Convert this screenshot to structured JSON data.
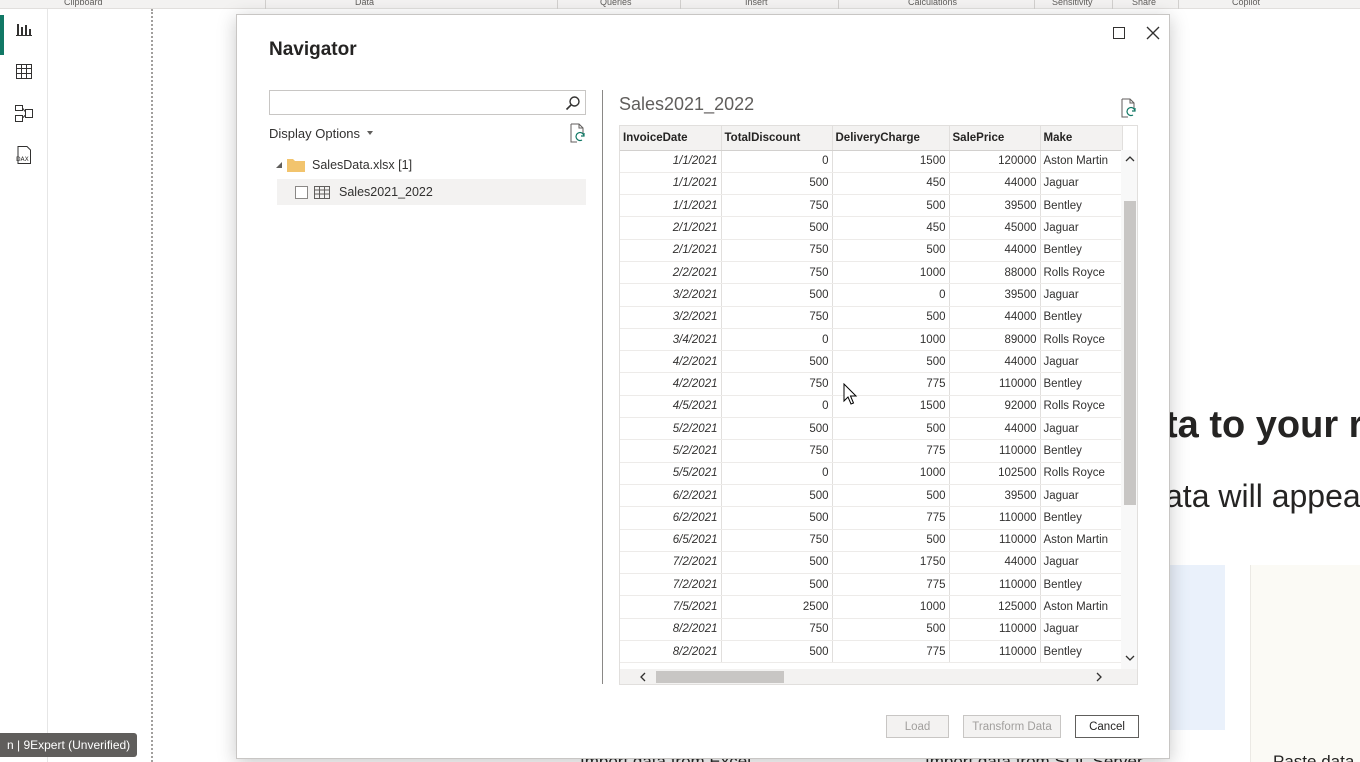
{
  "ribbon": {
    "groups": [
      "Clipboard",
      "Data",
      "Queries",
      "Insert",
      "Calculations",
      "Sensitivity",
      "Share",
      "Copilot"
    ]
  },
  "left_rail": {
    "items": [
      {
        "name": "report-view-icon",
        "active": true
      },
      {
        "name": "table-view-icon",
        "active": false
      },
      {
        "name": "model-view-icon",
        "active": false
      },
      {
        "name": "dax-query-view-icon",
        "active": false
      }
    ]
  },
  "background": {
    "heading": "ta to your r",
    "subheading": "ata will appea",
    "bottom_items": [
      "Import data from Excel",
      "Import data from SQL Server",
      "Paste data"
    ],
    "status_badge": "n | 9Expert (Unverified)"
  },
  "dialog": {
    "title": "Navigator",
    "search": {
      "value": "",
      "placeholder": ""
    },
    "display_options_label": "Display Options",
    "tree": {
      "file_label": "SalesData.xlsx [1]",
      "table_label": "Sales2021_2022",
      "table_checked": false
    },
    "preview": {
      "title": "Sales2021_2022",
      "columns": [
        "InvoiceDate",
        "TotalDiscount",
        "DeliveryCharge",
        "SalePrice",
        "Make"
      ],
      "rows": [
        [
          "1/1/2021",
          "0",
          "1500",
          "120000",
          "Aston Martin"
        ],
        [
          "1/1/2021",
          "500",
          "450",
          "44000",
          "Jaguar"
        ],
        [
          "1/1/2021",
          "750",
          "500",
          "39500",
          "Bentley"
        ],
        [
          "2/1/2021",
          "500",
          "450",
          "45000",
          "Jaguar"
        ],
        [
          "2/1/2021",
          "750",
          "500",
          "44000",
          "Bentley"
        ],
        [
          "2/2/2021",
          "750",
          "1000",
          "88000",
          "Rolls Royce"
        ],
        [
          "3/2/2021",
          "500",
          "0",
          "39500",
          "Jaguar"
        ],
        [
          "3/2/2021",
          "750",
          "500",
          "44000",
          "Bentley"
        ],
        [
          "3/4/2021",
          "0",
          "1000",
          "89000",
          "Rolls Royce"
        ],
        [
          "4/2/2021",
          "500",
          "500",
          "44000",
          "Jaguar"
        ],
        [
          "4/2/2021",
          "750",
          "775",
          "110000",
          "Bentley"
        ],
        [
          "4/5/2021",
          "0",
          "1500",
          "92000",
          "Rolls Royce"
        ],
        [
          "5/2/2021",
          "500",
          "500",
          "44000",
          "Jaguar"
        ],
        [
          "5/2/2021",
          "750",
          "775",
          "110000",
          "Bentley"
        ],
        [
          "5/5/2021",
          "0",
          "1000",
          "102500",
          "Rolls Royce"
        ],
        [
          "6/2/2021",
          "500",
          "500",
          "39500",
          "Jaguar"
        ],
        [
          "6/2/2021",
          "500",
          "775",
          "110000",
          "Bentley"
        ],
        [
          "6/5/2021",
          "750",
          "500",
          "110000",
          "Aston Martin"
        ],
        [
          "7/2/2021",
          "500",
          "1750",
          "44000",
          "Jaguar"
        ],
        [
          "7/2/2021",
          "500",
          "775",
          "110000",
          "Bentley"
        ],
        [
          "7/5/2021",
          "2500",
          "1000",
          "125000",
          "Aston Martin"
        ],
        [
          "8/2/2021",
          "750",
          "500",
          "110000",
          "Jaguar"
        ],
        [
          "8/2/2021",
          "500",
          "775",
          "110000",
          "Bentley"
        ]
      ]
    },
    "buttons": {
      "load": "Load",
      "transform": "Transform Data",
      "cancel": "Cancel"
    }
  },
  "colors": {
    "accent": "#117865",
    "folder": "#f2c46d",
    "status_badge_bg": "#605e5c"
  }
}
